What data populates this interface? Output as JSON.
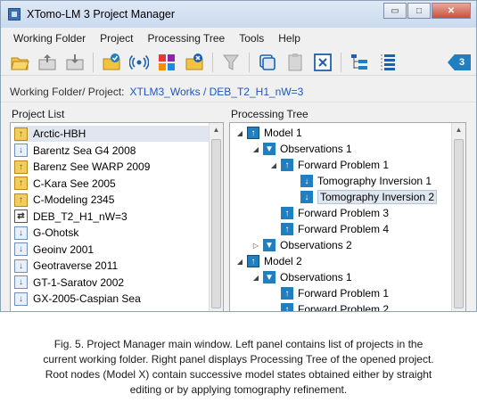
{
  "window": {
    "title": "XTomo-LM 3  Project Manager",
    "minimize_glyph": "▭",
    "maximize_glyph": "□",
    "close_glyph": "✕"
  },
  "menu": [
    "Working Folder",
    "Project",
    "Processing Tree",
    "Tools",
    "Help"
  ],
  "toolbar": {
    "icons": [
      "folder-open-icon",
      "folder-up-icon",
      "folder-down-icon",
      "project-check-icon",
      "broadcast-icon",
      "color-grid-icon",
      "folder-close-icon",
      "filter-icon",
      "copy-icon",
      "paste-icon",
      "close-box-icon",
      "tree-expand-icon",
      "tree-list-icon"
    ],
    "badge": "3"
  },
  "working_folder": {
    "label": "Working Folder/ Project:",
    "path": "XTLM3_Works / DEB_T2_H1_nW=3"
  },
  "project_list": {
    "title": "Project List",
    "items": [
      {
        "label": "Arctic-HBH",
        "icon": "folder-up",
        "selected": true
      },
      {
        "label": "Barentz Sea G4 2008",
        "icon": "folder-down"
      },
      {
        "label": "Barenz See WARP 2009",
        "icon": "folder-up"
      },
      {
        "label": "C-Kara See 2005",
        "icon": "folder-up"
      },
      {
        "label": "C-Modeling 2345",
        "icon": "folder-up"
      },
      {
        "label": "DEB_T2_H1_nW=3",
        "icon": "project-open"
      },
      {
        "label": "G-Ohotsk",
        "icon": "folder-down"
      },
      {
        "label": "Geoinv 2001",
        "icon": "folder-down"
      },
      {
        "label": "Geotraverse 2011",
        "icon": "folder-down"
      },
      {
        "label": "GT-1-Saratov 2002",
        "icon": "folder-down"
      },
      {
        "label": "GX-2005-Caspian Sea",
        "icon": "folder-down"
      }
    ]
  },
  "processing_tree": {
    "title": "Processing Tree",
    "nodes": [
      {
        "label": "Model 1",
        "type": "model",
        "level": 0,
        "expander": "◢"
      },
      {
        "label": "Observations 1",
        "type": "obs",
        "level": 1,
        "expander": "◢"
      },
      {
        "label": "Forward Problem 1",
        "type": "up",
        "level": 2,
        "expander": "◢"
      },
      {
        "label": "Tomography Inversion 1",
        "type": "down",
        "level": 3,
        "expander": ""
      },
      {
        "label": "Tomography Inversion 2",
        "type": "down",
        "level": 3,
        "expander": "",
        "selected": true
      },
      {
        "label": "Forward Problem 3",
        "type": "up",
        "level": 2,
        "expander": ""
      },
      {
        "label": "Forward Problem 4",
        "type": "up",
        "level": 2,
        "expander": ""
      },
      {
        "label": "Observations 2",
        "type": "obs",
        "level": 1,
        "expander": "▷"
      },
      {
        "label": "Model 2",
        "type": "model",
        "level": 0,
        "expander": "◢"
      },
      {
        "label": "Observations 1",
        "type": "obs",
        "level": 1,
        "expander": "◢"
      },
      {
        "label": "Forward Problem 1",
        "type": "up",
        "level": 2,
        "expander": ""
      },
      {
        "label": "Forward Problem 2",
        "type": "up",
        "level": 2,
        "expander": ""
      }
    ]
  },
  "caption": [
    "Fig. 5. Project Manager main window. Left panel contains list of projects in the",
    "current working folder. Right panel displays Processing Tree of the opened project.",
    "Root nodes (Model X) contain successive  model states  obtained either by straight",
    "editing or by applying tomography refinement."
  ]
}
